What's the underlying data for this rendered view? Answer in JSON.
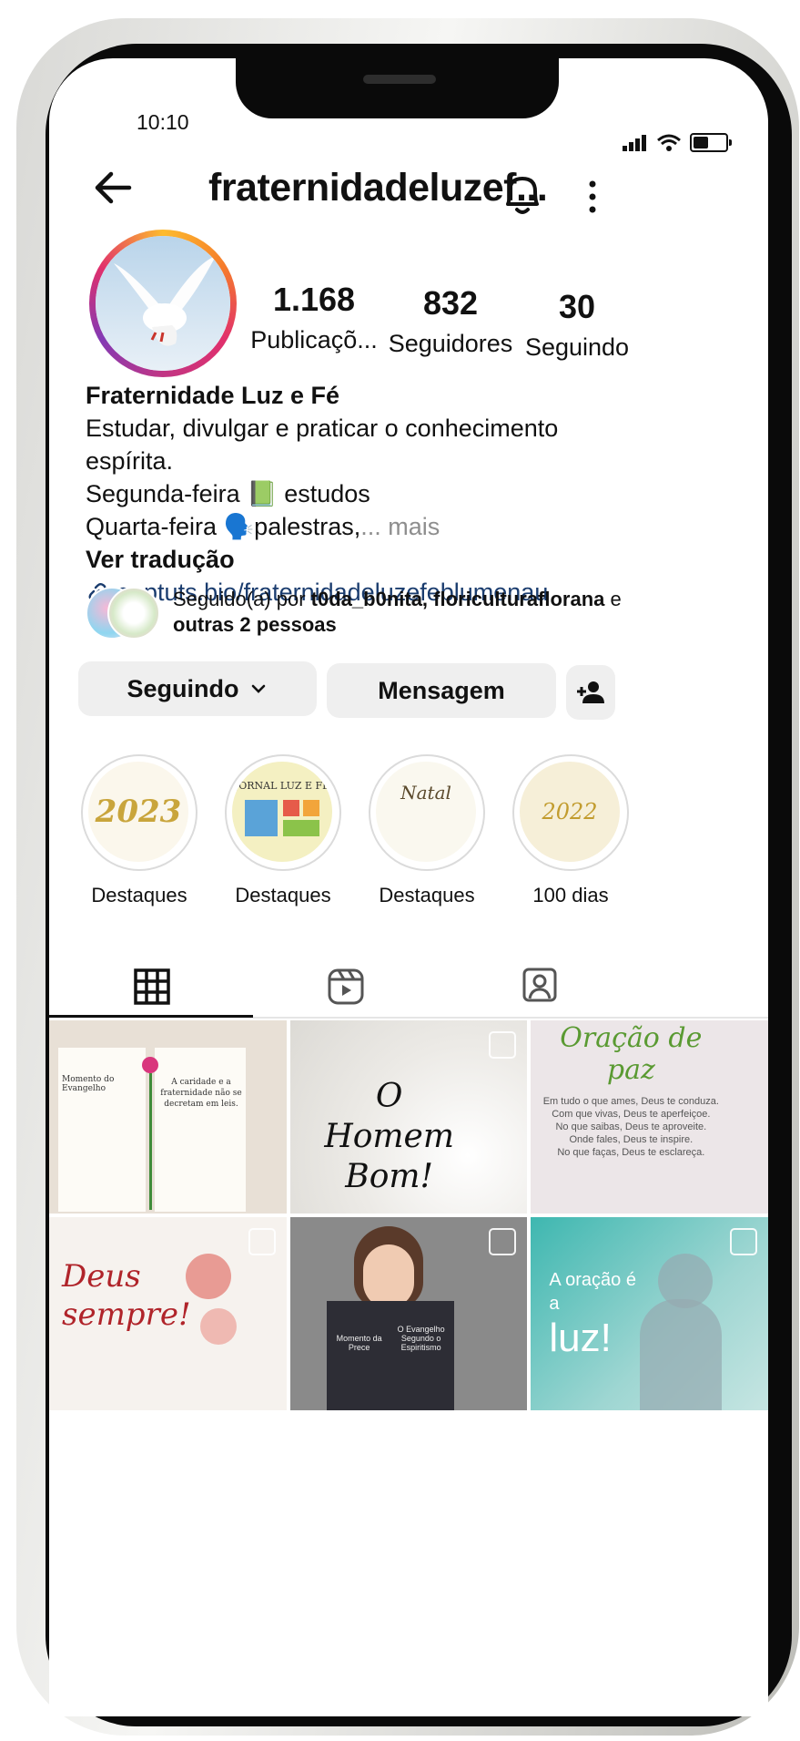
{
  "status_bar": {
    "time": "10:10"
  },
  "header": {
    "username": "fraternidadeluzef..."
  },
  "profile": {
    "stats": [
      {
        "value": "1.168",
        "label": "Publicaçõ..."
      },
      {
        "value": "832",
        "label": "Seguidores"
      },
      {
        "value": "30",
        "label": "Seguindo"
      }
    ],
    "name": "Fraternidade Luz e Fé",
    "bio_lines": [
      "Estudar, divulgar e praticar o conhecimento espírita.",
      "Segunda-feira 📗 estudos",
      "Quarta-feira 🗣️palestras,"
    ],
    "more_label": "... mais",
    "translate_label": "Ver tradução",
    "link": "apptuts.bio/fraternidadeluzefeblumenau",
    "followed_by_prefix": "Seguido(a) por",
    "followed_by_names": "t0da_b0nita, floriculturaflorana",
    "followed_by_and": "e",
    "followed_by_others": "outras 2 pessoas"
  },
  "actions": {
    "following_label": "Seguindo",
    "message_label": "Mensagem"
  },
  "highlights": [
    {
      "label": "Destaques",
      "cover_text": "2023"
    },
    {
      "label": "Destaques",
      "cover_text": "JORNAL LUZ E FÉ"
    },
    {
      "label": "Destaques",
      "cover_text": "Natal"
    },
    {
      "label": "100 dias",
      "cover_text": "2022"
    }
  ],
  "posts": [
    {
      "caption": "Momento do Evangelho",
      "quote": "A caridade e a fraternidade não se decretam em leis."
    },
    {
      "caption": "O Homem Bom!"
    },
    {
      "caption": "Oração de paz",
      "lines": [
        "Em tudo o que ames, Deus te conduza.",
        "Com que vivas, Deus te aperfeiçoe.",
        "No que saibas, Deus te aproveite.",
        "Onde fales, Deus te inspire.",
        "No que faças, Deus te esclareça."
      ]
    },
    {
      "caption": "Deus sempre!"
    },
    {
      "caption": "Momento da Prece",
      "caption2": "O Evangelho Segundo o Espiritismo"
    },
    {
      "caption": "A oração é a",
      "caption_big": "luz!"
    }
  ],
  "colors": {
    "text": "#111111",
    "link": "#1a3c6e",
    "button_bg": "#efefef",
    "muted": "#8e8e8e"
  }
}
